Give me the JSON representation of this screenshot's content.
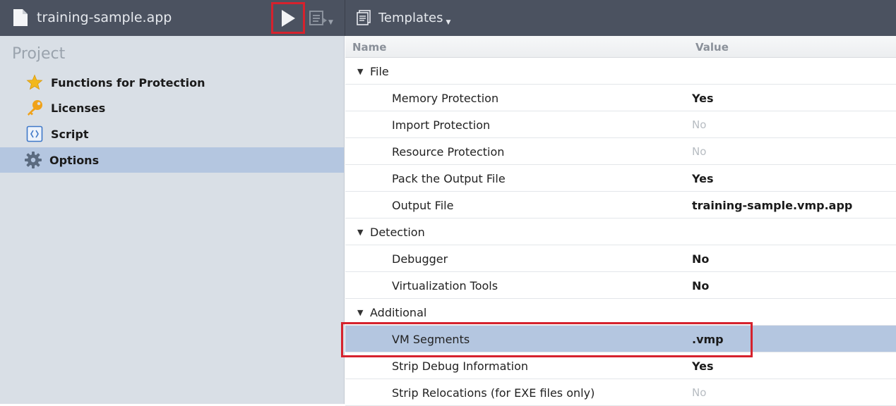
{
  "toolbar": {
    "doc_title": "training-sample.app",
    "run_icon": "play-icon",
    "compile_icon": "compile-icon",
    "templates_label": "Templates",
    "templates_icon": "templates-icon"
  },
  "sidebar": {
    "heading": "Project",
    "items": [
      {
        "label": "Functions for Protection",
        "icon": "star-icon"
      },
      {
        "label": "Licenses",
        "icon": "key-icon"
      },
      {
        "label": "Script",
        "icon": "script-icon"
      },
      {
        "label": "Options",
        "icon": "gear-icon",
        "selected": true
      }
    ]
  },
  "grid": {
    "columns": {
      "name": "Name",
      "value": "Value"
    },
    "groups": [
      {
        "name": "File",
        "rows": [
          {
            "name": "Memory Protection",
            "value": "Yes"
          },
          {
            "name": "Import Protection",
            "value": "No"
          },
          {
            "name": "Resource Protection",
            "value": "No"
          },
          {
            "name": "Pack the Output File",
            "value": "Yes"
          },
          {
            "name": "Output File",
            "value": "training-sample.vmp.app"
          }
        ]
      },
      {
        "name": "Detection",
        "rows": [
          {
            "name": "Debugger",
            "value": "No"
          },
          {
            "name": "Virtualization Tools",
            "value": "No"
          }
        ]
      },
      {
        "name": "Additional",
        "rows": [
          {
            "name": "VM Segments",
            "value": ".vmp",
            "selected": true
          },
          {
            "name": "Strip Debug Information",
            "value": "Yes"
          },
          {
            "name": "Strip Relocations (for EXE files only)",
            "value": "No"
          }
        ]
      }
    ]
  },
  "colors": {
    "toolbar_bg": "#4b5260",
    "sidebar_bg": "#d9dfe6",
    "selection": "#b4c6e0",
    "annotation_red": "#d6222d"
  }
}
